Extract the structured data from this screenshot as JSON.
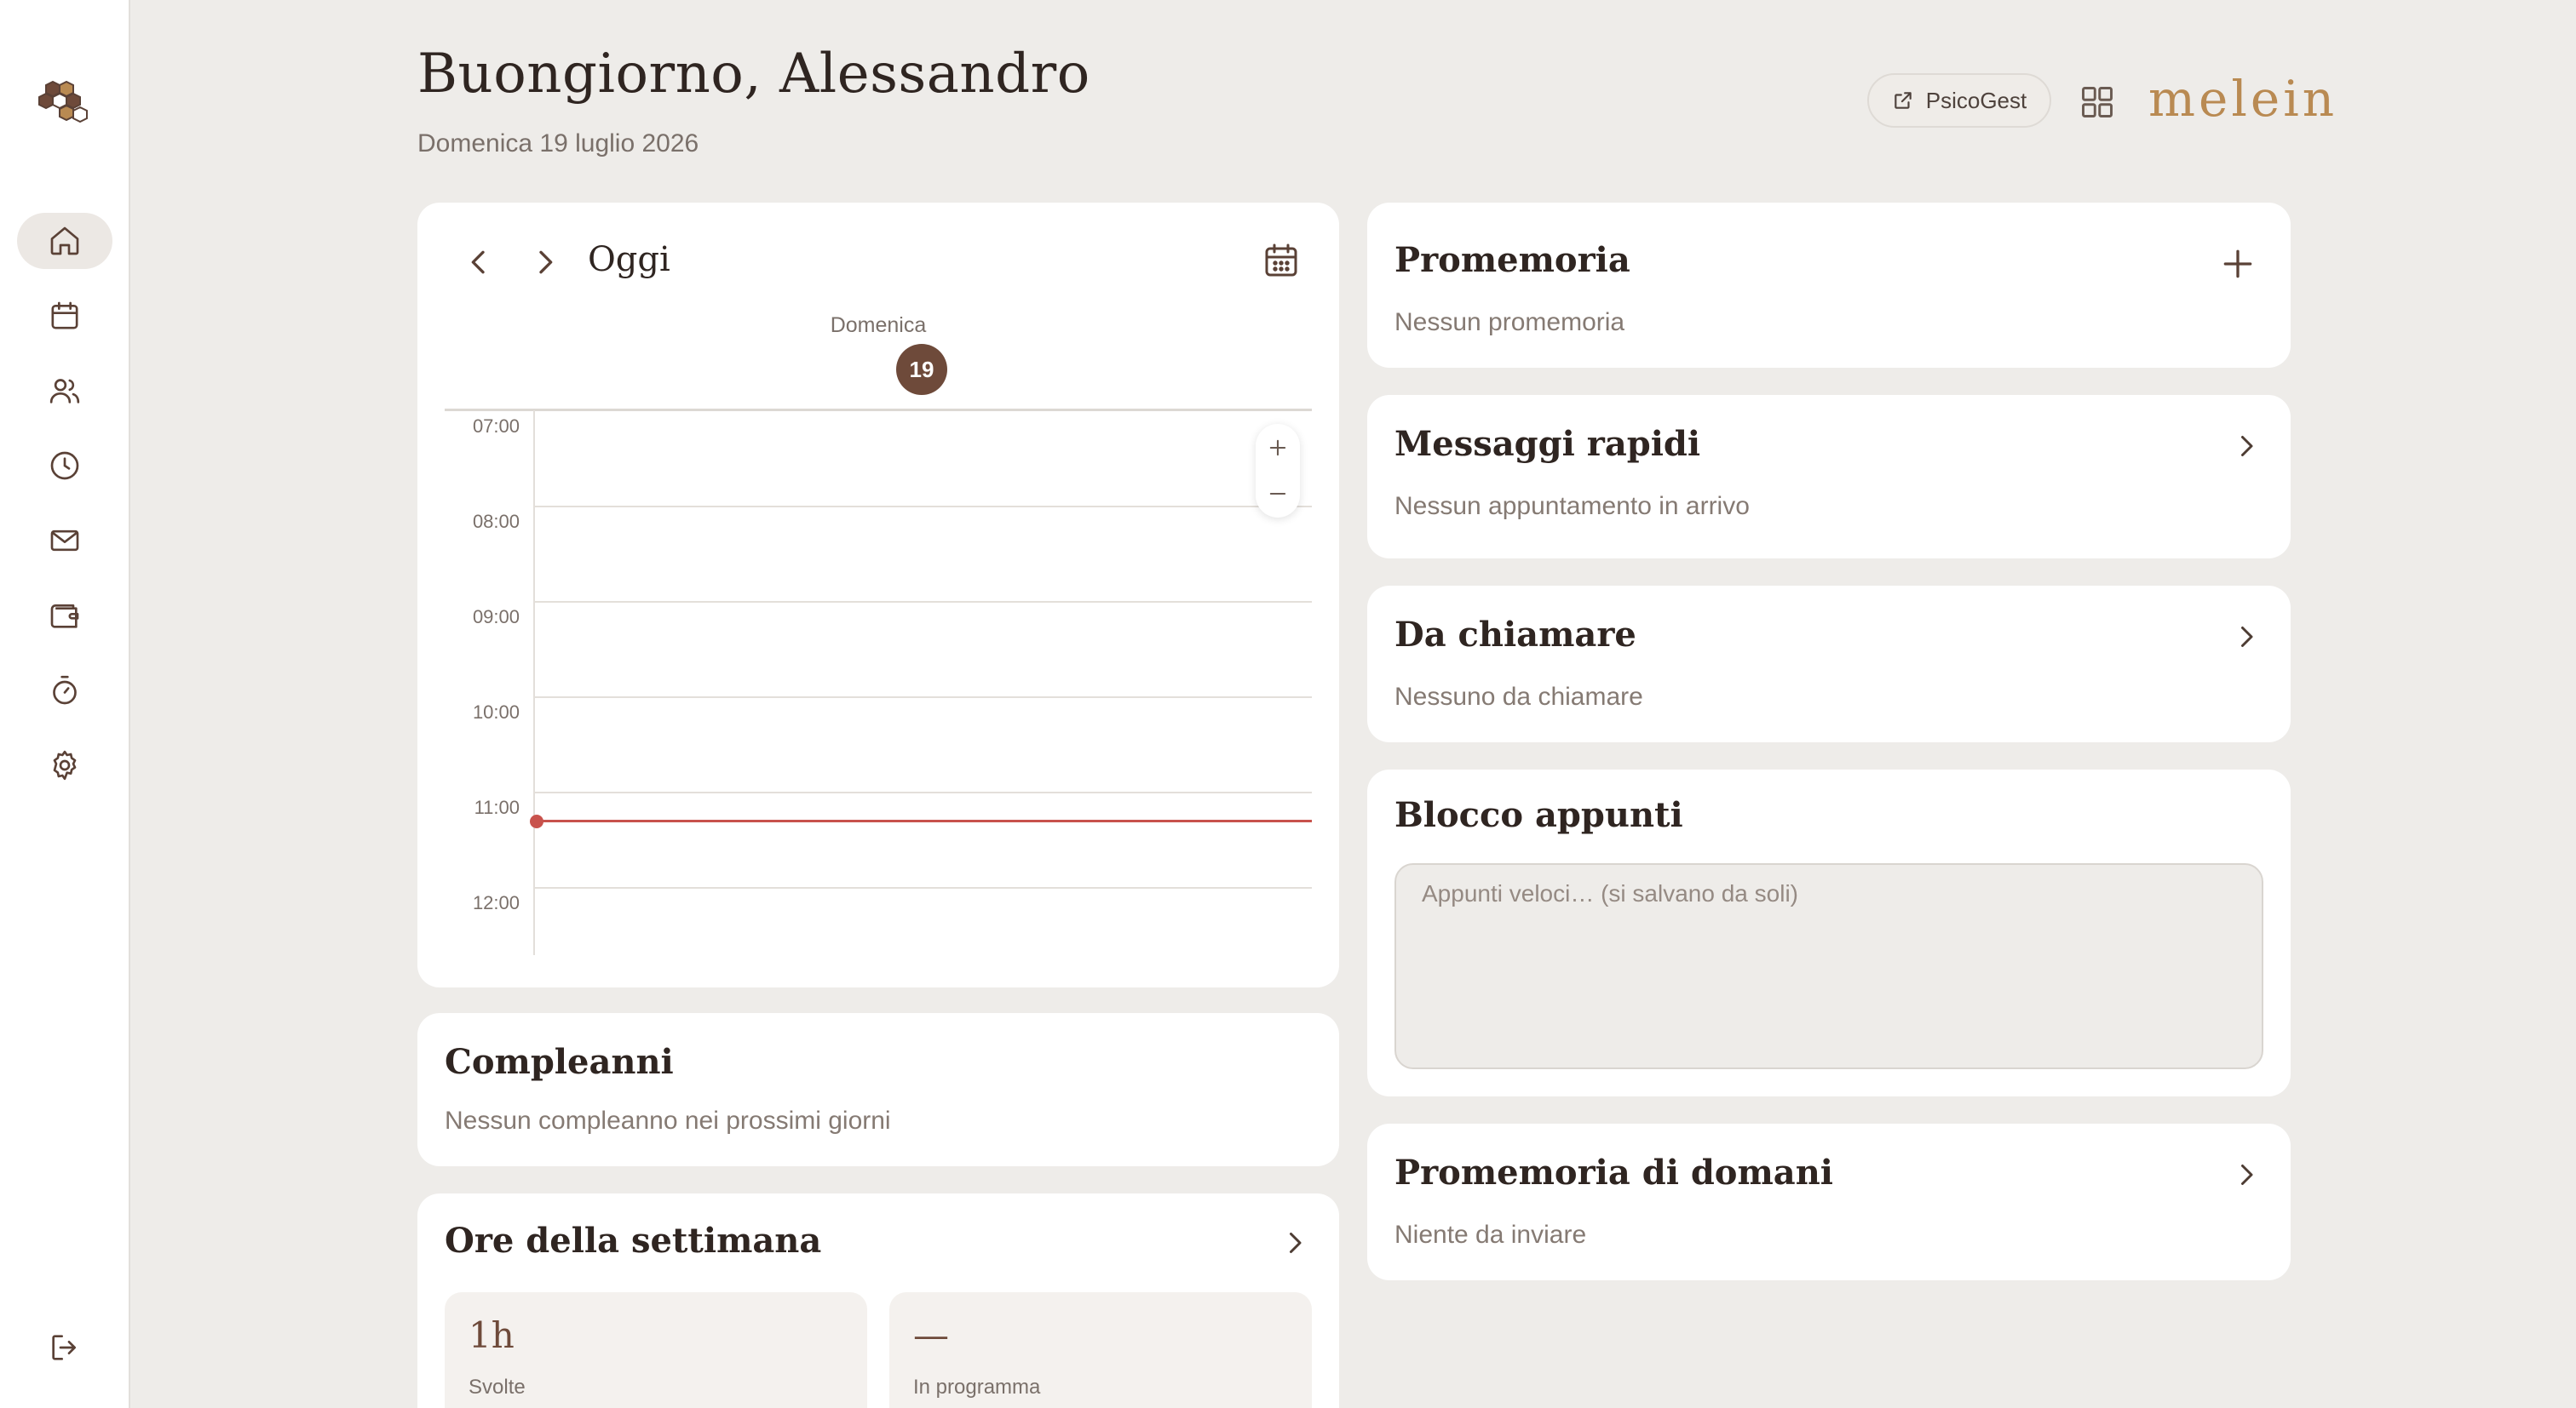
{
  "sidebar": {
    "items": [
      {
        "icon": "home-icon",
        "label": "Home"
      },
      {
        "icon": "calendar-icon",
        "label": "Calendario"
      },
      {
        "icon": "users-icon",
        "label": "Pazienti"
      },
      {
        "icon": "clock-icon",
        "label": "Ore"
      },
      {
        "icon": "mail-icon",
        "label": "Messaggi"
      },
      {
        "icon": "wallet-icon",
        "label": "Pagamenti"
      },
      {
        "icon": "timer-icon",
        "label": "Timer"
      },
      {
        "icon": "gear-icon",
        "label": "Impostazioni"
      }
    ],
    "logout_icon": "logout-icon"
  },
  "header": {
    "greeting": "Buongiorno, Alessandro",
    "date": "Domenica 19 luglio 2026",
    "psico_button": "PsicoGest",
    "brand": "melein"
  },
  "calendar": {
    "today_label": "Oggi",
    "day_name": "Domenica",
    "day_number": "19",
    "hours": [
      "07:00",
      "08:00",
      "09:00",
      "10:00",
      "11:00",
      "12:00"
    ],
    "zoom_in": "+",
    "zoom_out": "−"
  },
  "birthdays": {
    "title": "Compleanni",
    "empty": "Nessun compleanno nei prossimi giorni"
  },
  "week_hours": {
    "title": "Ore della settimana",
    "stats": [
      {
        "value": "1h",
        "label": "Svolte"
      },
      {
        "value": "—",
        "label": "In programma"
      }
    ]
  },
  "reminders": {
    "title": "Promemoria",
    "empty": "Nessun promemoria"
  },
  "quick_messages": {
    "title": "Messaggi rapidi",
    "empty": "Nessun appuntamento in arrivo"
  },
  "to_call": {
    "title": "Da chiamare",
    "empty": "Nessuno da chiamare"
  },
  "notepad": {
    "title": "Blocco appunti",
    "placeholder": "Appunti veloci… (si salvano da soli)",
    "value": ""
  },
  "tomorrow_reminders": {
    "title": "Promemoria di domani",
    "empty": "Niente da inviare"
  },
  "colors": {
    "accent": "#6e4a3a",
    "brand": "#b98a52",
    "now_line": "#c8524c",
    "background": "#eeece9"
  }
}
